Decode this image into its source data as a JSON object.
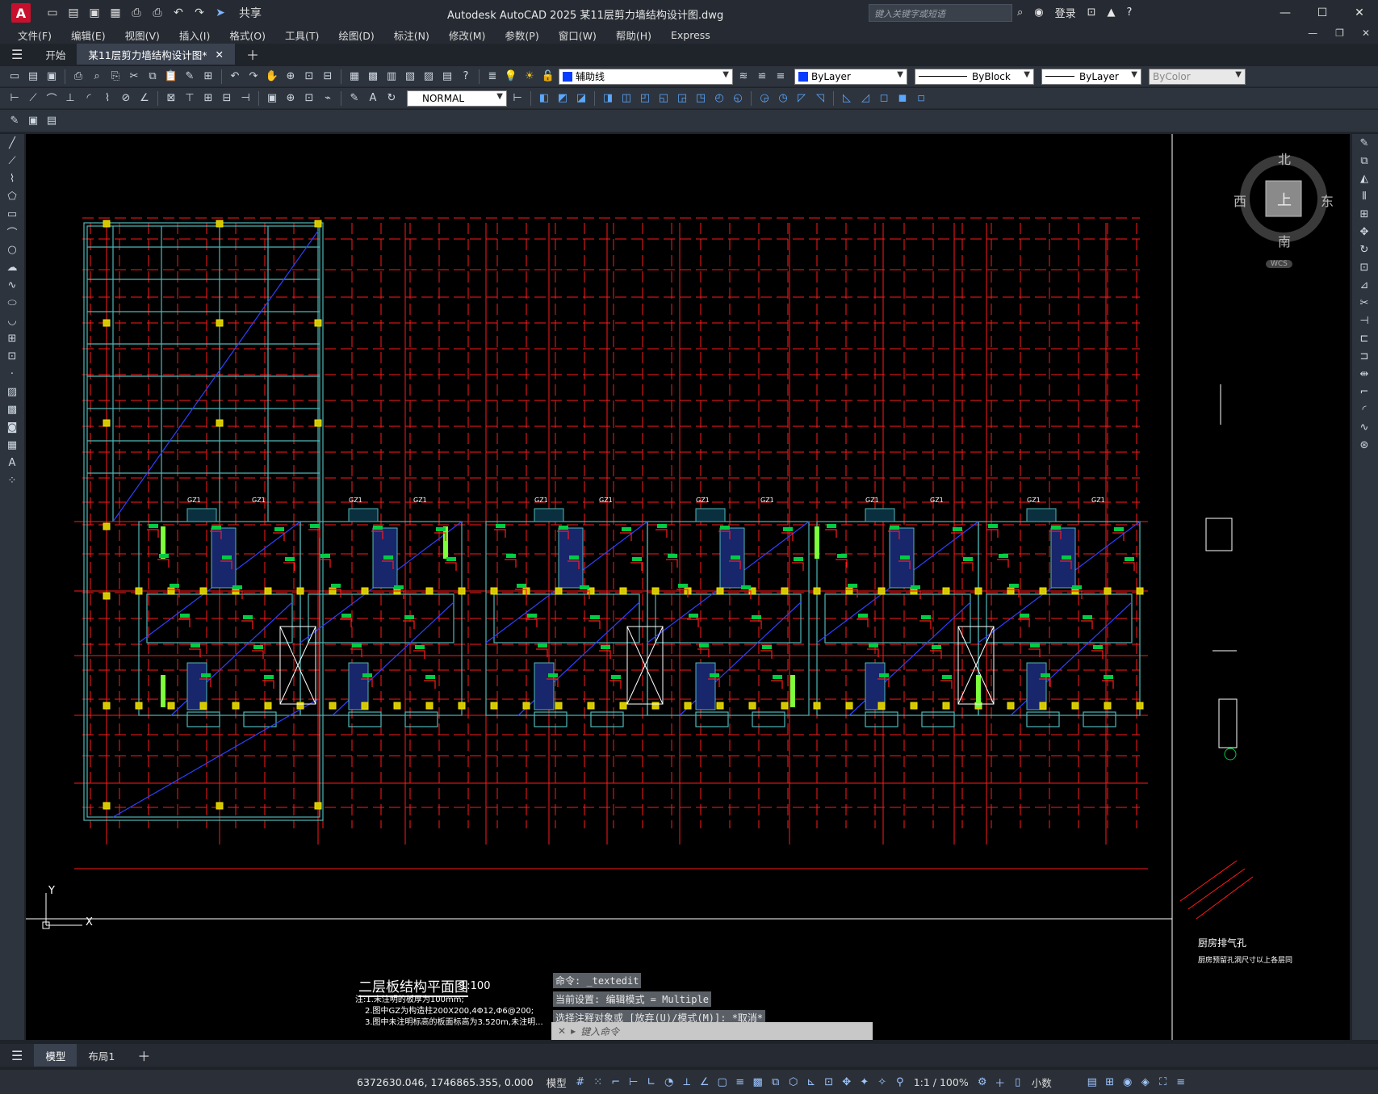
{
  "titlebar": {
    "app_letter": "A",
    "share_label": "共享",
    "window_title": "Autodesk AutoCAD 2025    某11层剪力墙结构设计图.dwg",
    "search_placeholder": "键入关键字或短语",
    "login_label": "登录"
  },
  "menubar": {
    "items": [
      "文件(F)",
      "编辑(E)",
      "视图(V)",
      "插入(I)",
      "格式(O)",
      "工具(T)",
      "绘图(D)",
      "标注(N)",
      "修改(M)",
      "参数(P)",
      "窗口(W)",
      "帮助(H)",
      "Express"
    ]
  },
  "tabs": {
    "start": "开始",
    "drawing": "某11层剪力墙结构设计图*"
  },
  "properties": {
    "layer": "辅助线",
    "color": "ByLayer",
    "linetype": "ByBlock",
    "lineweight": "ByLayer",
    "plotstyle": "ByColor",
    "dimstyle": "NORMAL",
    "layer_color": "#0a3cff"
  },
  "compass": {
    "north": "北",
    "south": "南",
    "east": "东",
    "west": "西",
    "top": "上",
    "wcs": "WCS"
  },
  "drawing": {
    "title": "二层板结构平面图",
    "scale": "1:100",
    "notes": [
      "注:1.未注明的板厚为100mm;",
      "2.图中GZ为构造柱200X200,4Φ12,Φ6@200;",
      "3.图中未注明标高的板面标高为3.520m,未注明..."
    ],
    "label_gz": "GZ1",
    "right_annotation": "厨房排气孔",
    "right_note": "厨房预留孔洞尺寸以上各层同",
    "axis_y": "Y",
    "axis_x": "X"
  },
  "command": {
    "history": [
      "命令: _textedit",
      "当前设置: 编辑模式 = Multiple",
      "选择注释对象或 [放弃(U)/模式(M)]: *取消*"
    ],
    "placeholder": "键入命令"
  },
  "layouts": {
    "model": "模型",
    "layout1": "布局1"
  },
  "status": {
    "coordinates": "6372630.046, 1746865.355, 0.000",
    "model": "模型",
    "scale": "1:1 / 100%",
    "units": "小数"
  }
}
